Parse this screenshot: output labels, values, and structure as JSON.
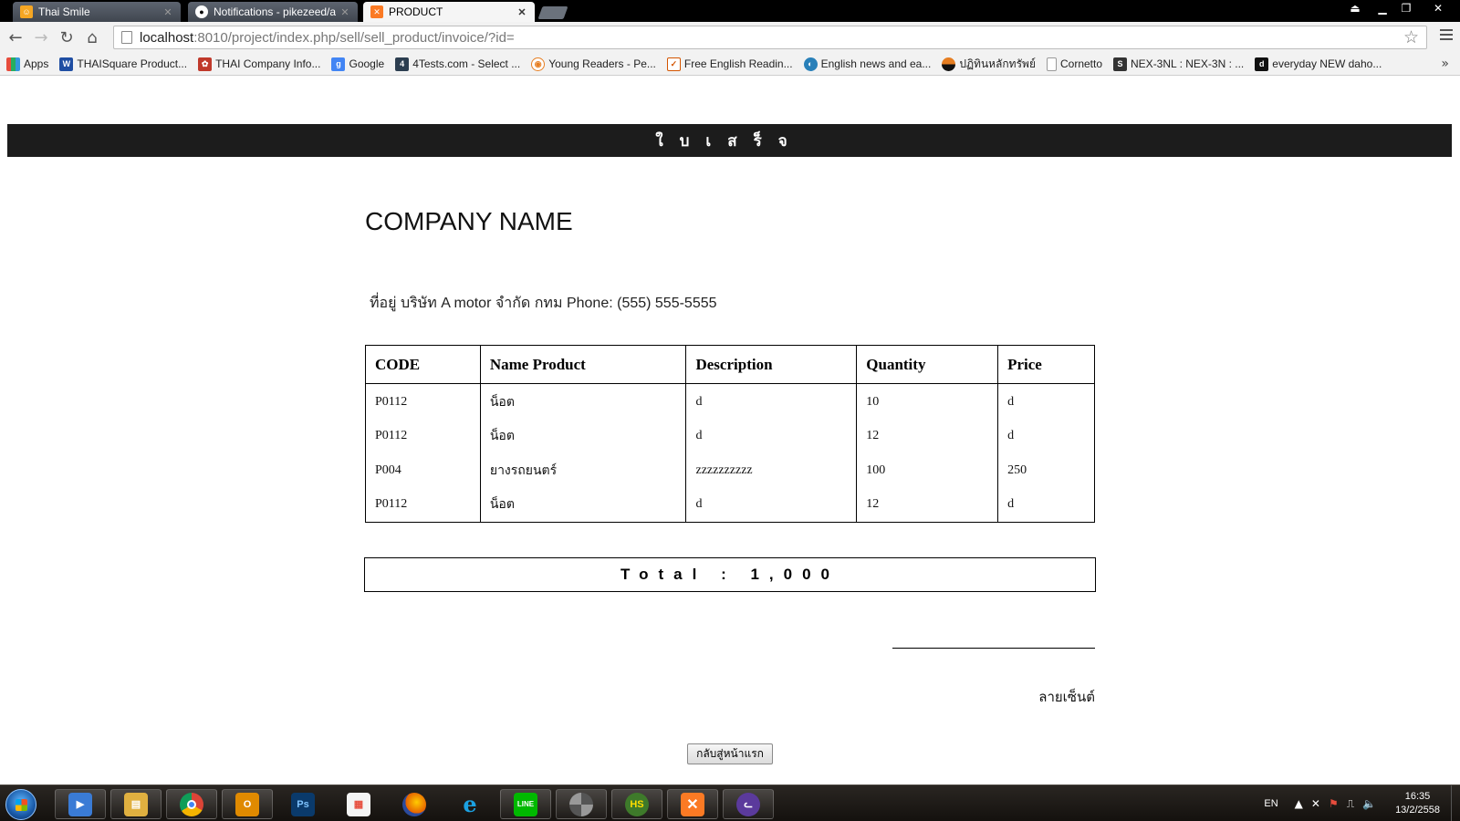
{
  "browser": {
    "tabs": [
      {
        "title": "Thai Smile",
        "icon": "thai-smile-favicon",
        "active": false
      },
      {
        "title": "Notifications - pikezeed/al",
        "icon": "github-favicon",
        "active": false
      },
      {
        "title": "PRODUCT",
        "icon": "xampp-favicon",
        "active": true
      }
    ],
    "url_host": "localhost",
    "url_rest": ":8010/project/index.php/sell/sell_product/invoice/?id=",
    "bookmarks": [
      {
        "label": "Apps",
        "icon": "apps-grid-icon",
        "color": "#e74c3c"
      },
      {
        "label": "THAISquare Product...",
        "icon": "thaisquare-icon",
        "color": "#1f4ea3"
      },
      {
        "label": "THAI Company Info...",
        "icon": "thai-company-icon",
        "color": "#c0392b"
      },
      {
        "label": "Google",
        "icon": "google-icon",
        "color": "#4285f4"
      },
      {
        "label": "4Tests.com - Select ...",
        "icon": "4tests-icon",
        "color": "#2c3e50"
      },
      {
        "label": "Young Readers - Pe...",
        "icon": "young-readers-icon",
        "color": "#e67e22"
      },
      {
        "label": "Free English Readin...",
        "icon": "free-english-icon",
        "color": "#d35400"
      },
      {
        "label": "English news and ea...",
        "icon": "english-news-icon",
        "color": "#2980b9"
      },
      {
        "label": "ปฏิทินหลักทรัพย์",
        "icon": "calendar-site-icon",
        "color": "#e67e22"
      },
      {
        "label": "Cornetto",
        "icon": "page-icon",
        "color": "#bbbbbb"
      },
      {
        "label": "NEX-3NL : NEX-3N : ...",
        "icon": "nex-icon",
        "color": "#333333"
      },
      {
        "label": "everyday NEW daho...",
        "icon": "dahong-icon",
        "color": "#111111"
      }
    ]
  },
  "invoice": {
    "banner": "ใบเสร็จ",
    "company_name": "COMPANY NAME",
    "address": "ที่อยู่ บริษัท A motor จำกัด กทม Phone: (555) 555-5555",
    "columns": [
      "CODE",
      "Name Product",
      "Description",
      "Quantity",
      "Price"
    ],
    "rows": [
      {
        "code": "P0112",
        "name": "น็อต",
        "description": "d",
        "quantity": "10",
        "price": "d"
      },
      {
        "code": "P0112",
        "name": "น็อต",
        "description": "d",
        "quantity": "12",
        "price": "d"
      },
      {
        "code": "P004",
        "name": "ยางรถยนตร์",
        "description": "zzzzzzzzzz",
        "quantity": "100",
        "price": "250"
      },
      {
        "code": "P0112",
        "name": "น็อต",
        "description": "d",
        "quantity": "12",
        "price": "d"
      }
    ],
    "total_text": "Total : 1,000",
    "signature_label": "ลายเซ็นต์",
    "home_button": "กลับสู่หน้าแรก"
  },
  "taskbar": {
    "apps": [
      {
        "name": "media-player-icon",
        "color": "#3a7bd5",
        "pinned": true
      },
      {
        "name": "file-explorer-icon",
        "color": "#e0b040",
        "pinned": true
      },
      {
        "name": "chrome-icon",
        "color": "#db4437",
        "pinned": true
      },
      {
        "name": "outlook-icon",
        "color": "#e08a00",
        "pinned": true
      },
      {
        "name": "photoshop-icon",
        "color": "#0a3a6b",
        "pinned": false,
        "glyph": "Ps"
      },
      {
        "name": "apps-grid-icon",
        "color": "#f4f4f4",
        "pinned": false
      },
      {
        "name": "firefox-icon",
        "color": "#e66000",
        "pinned": false
      },
      {
        "name": "internet-explorer-icon",
        "color": "#1ba1e2",
        "pinned": false
      },
      {
        "name": "line-icon",
        "color": "#00b900",
        "pinned": true,
        "glyph": "LINE"
      },
      {
        "name": "disc-app-icon",
        "color": "#555555",
        "pinned": true
      },
      {
        "name": "hs-app-icon",
        "color": "#3e7a2a",
        "pinned": true,
        "glyph": "HS"
      },
      {
        "name": "xampp-icon",
        "color": "#fb7a24",
        "pinned": true
      },
      {
        "name": "cat-app-icon",
        "color": "#5b3a9c",
        "pinned": true
      }
    ],
    "lang": "EN",
    "time": "16:35",
    "date": "13/2/2558"
  }
}
